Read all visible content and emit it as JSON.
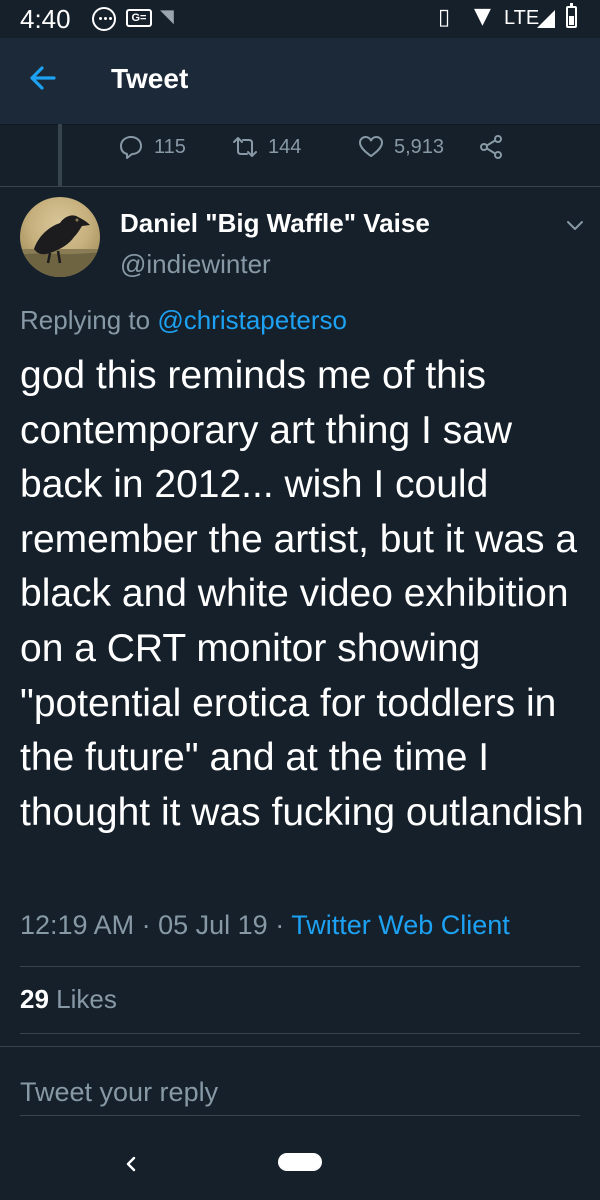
{
  "status_bar": {
    "time": "4:40",
    "ge_badge": "G=",
    "network": "LTE",
    "icons": [
      "message-bubble-icon",
      "ge-badge-icon",
      "wifi-question-icon",
      "vibrate-icon",
      "wifi-icon",
      "signal-icon",
      "battery-icon"
    ]
  },
  "header": {
    "title": "Tweet",
    "back_icon": "back-arrow-icon"
  },
  "previous_tweet_actions": {
    "replies": "115",
    "retweets": "144",
    "likes": "5,913",
    "icons": [
      "reply-icon",
      "retweet-icon",
      "like-icon",
      "share-icon"
    ]
  },
  "tweet": {
    "display_name": "Daniel \"Big Waffle\" Vaise",
    "handle": "@indiewinter",
    "replying_prefix": "Replying to",
    "replying_to": "@christapeterso",
    "text": "god this reminds me of this contemporary art thing I saw back in 2012... wish I could remember the artist, but it was a black and white video exhibition on a CRT monitor showing \"potential erotica for toddlers in the future\" and at the time I thought it was fucking outlandish",
    "time": "12:19 AM",
    "date": "05 Jul 19",
    "source": "Twitter Web Client",
    "likes_count": "29",
    "likes_label": "Likes"
  },
  "reply_bar": {
    "placeholder": "Tweet your reply"
  },
  "colors": {
    "background": "#15202b",
    "header_bg": "#1c2938",
    "accent": "#1da1f2",
    "secondary_text": "#8899a6",
    "divider": "#38444d"
  }
}
